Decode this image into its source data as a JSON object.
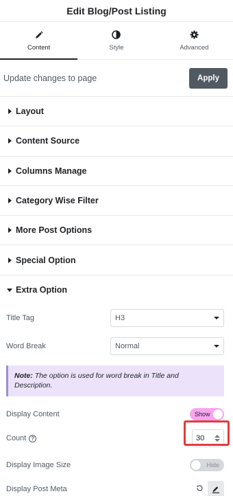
{
  "header": {
    "title": "Edit Blog/Post Listing"
  },
  "tabs": [
    {
      "label": "Content",
      "icon": "pencil-icon",
      "active": true
    },
    {
      "label": "Style",
      "icon": "half-circle-icon",
      "active": false
    },
    {
      "label": "Advanced",
      "icon": "gear-icon",
      "active": false
    }
  ],
  "apply": {
    "text": "Update changes to page",
    "button": "Apply"
  },
  "sections": [
    {
      "label": "Layout"
    },
    {
      "label": "Content Source"
    },
    {
      "label": "Columns Manage"
    },
    {
      "label": "Category Wise Filter"
    },
    {
      "label": "More Post Options"
    },
    {
      "label": "Special Option"
    }
  ],
  "extra": {
    "label": "Extra Option",
    "title_tag": {
      "label": "Title Tag",
      "value": "H3"
    },
    "word_break": {
      "label": "Word Break",
      "value": "Normal"
    },
    "note": {
      "prefix": "Note:",
      "text": "The option is used for word break in Title and Description."
    },
    "display_content": {
      "label": "Display Content",
      "state": "Show"
    },
    "count": {
      "label": "Count",
      "value": "30"
    },
    "display_image_size": {
      "label": "Display Image Size",
      "state": "Hide"
    },
    "display_post_meta": {
      "label": "Display Post Meta"
    }
  }
}
